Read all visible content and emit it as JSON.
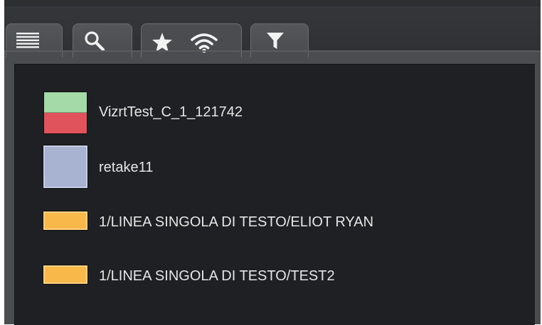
{
  "tabs": [
    {
      "id": "list",
      "icon": "list-icon"
    },
    {
      "id": "search",
      "icon": "search-icon"
    },
    {
      "id": "favorites",
      "icons": [
        "star-icon",
        "wifi-icon"
      ],
      "active": true
    },
    {
      "id": "filter",
      "icon": "filter-icon"
    }
  ],
  "items": [
    {
      "label": "VizrtTest_C_1_121742",
      "swatch": "split",
      "colors": [
        "#a4d9a8",
        "#e0525c"
      ]
    },
    {
      "label": "retake11",
      "swatch": "plain",
      "colors": [
        "#a8b3d2"
      ]
    },
    {
      "label": "1/LINEA SINGOLA DI TESTO/ELIOT RYAN",
      "swatch": "strip",
      "colors": [
        "#f8b84a"
      ]
    },
    {
      "label": "1/LINEA SINGOLA DI TESTO/TEST2",
      "swatch": "strip",
      "colors": [
        "#f8b84a"
      ]
    }
  ]
}
